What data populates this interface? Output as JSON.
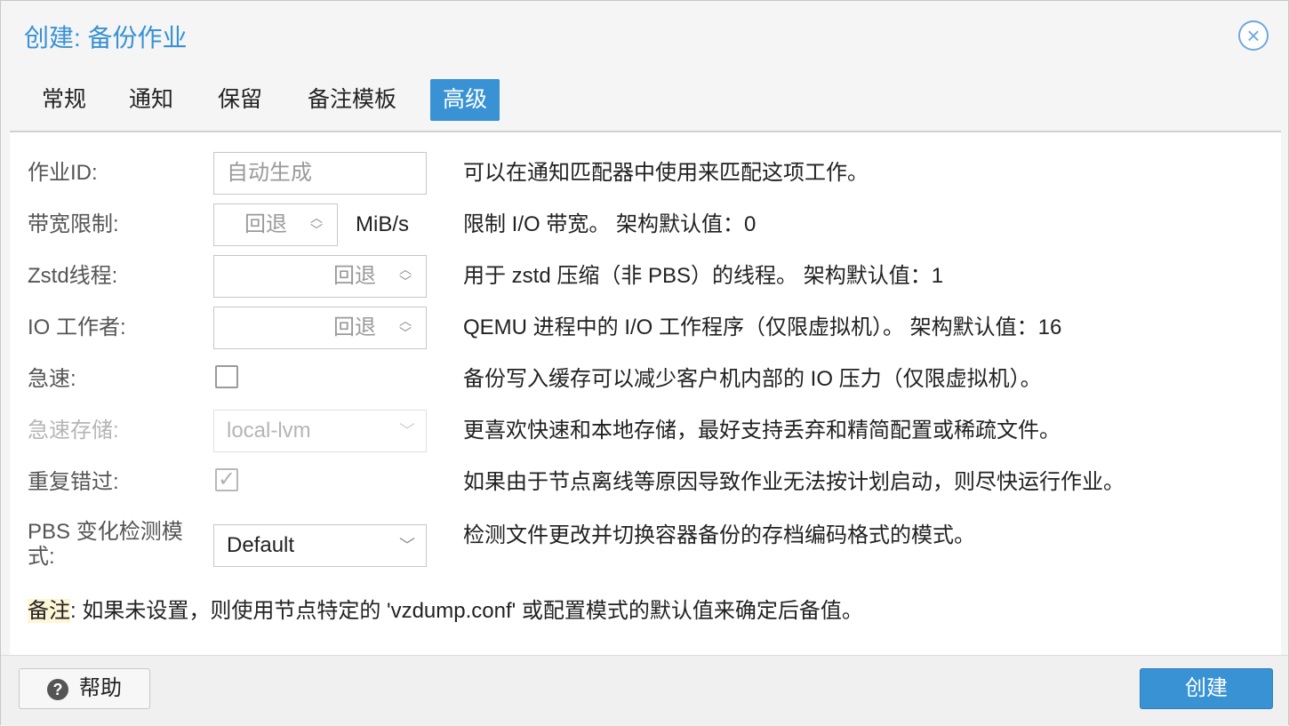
{
  "dialog": {
    "title": "创建: 备份作业",
    "close_icon": "close-circle-icon"
  },
  "tabs": [
    {
      "label": "常规",
      "active": false
    },
    {
      "label": "通知",
      "active": false
    },
    {
      "label": "保留",
      "active": false
    },
    {
      "label": "备注模板",
      "active": false
    },
    {
      "label": "高级",
      "active": true
    }
  ],
  "fields": {
    "job_id": {
      "label": "作业ID:",
      "placeholder": "自动生成",
      "desc": "可以在通知匹配器中使用来匹配这项工作。"
    },
    "bwlimit": {
      "label": "带宽限制:",
      "placeholder": "回退",
      "unit": "MiB/s",
      "desc": "限制 I/O 带宽。 架构默认值：0"
    },
    "zstd": {
      "label": "Zstd线程:",
      "placeholder": "回退",
      "desc": "用于 zstd 压缩（非 PBS）的线程。 架构默认值：1"
    },
    "io_workers": {
      "label": "IO 工作者:",
      "placeholder": "回退",
      "desc": "QEMU 进程中的 I/O 工作程序（仅限虚拟机）。 架构默认值：16"
    },
    "fleecing": {
      "label": "急速:",
      "checked": false,
      "desc": "备份写入缓存可以减少客户机内部的 IO 压力（仅限虚拟机）。"
    },
    "fleecing_storage": {
      "label": "急速存储:",
      "value": "local-lvm",
      "desc": "更喜欢快速和本地存储，最好支持丢弃和精简配置或稀疏文件。"
    },
    "repeat_missed": {
      "label": "重复错过:",
      "checked": true,
      "desc": "如果由于节点离线等原因导致作业无法按计划启动，则尽快运行作业。"
    },
    "pbs_mode": {
      "label_line1": "PBS 变化检测模",
      "label_line2": "式:",
      "value": "Default",
      "desc": "检测文件更改并切换容器备份的存档编码格式的模式。"
    }
  },
  "note": {
    "prefix": "备注",
    "text": ": 如果未设置，则使用节点特定的 'vzdump.conf' 或配置模式的默认值来确定后备值。"
  },
  "footer": {
    "help_label": "帮助",
    "help_icon": "question-circle-icon",
    "create_label": "创建"
  }
}
